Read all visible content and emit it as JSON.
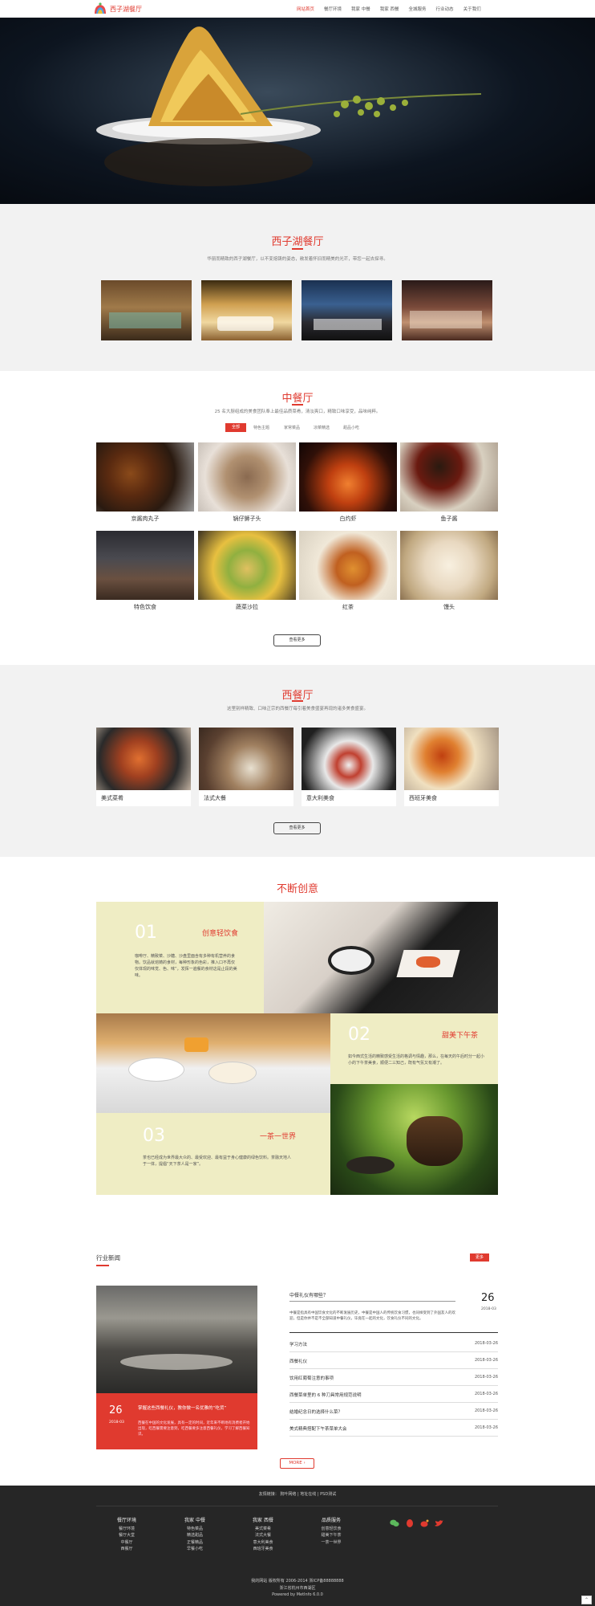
{
  "header": {
    "logo_text": "西子湖餐厅",
    "menu": [
      "网站首页",
      "餐厅环境",
      "我家 中餐",
      "我家 西餐",
      "全城服务",
      "行业动态",
      "关于我们"
    ]
  },
  "about": {
    "title": "西子湖餐厅",
    "subtitle": "华丽而精致的西子湖餐厅，以不变熔铸的姿态，敞发着怀旧而精美的光芒，带您一起去探寻。"
  },
  "chinese": {
    "title": "中餐厅",
    "subtitle": "25 名大厨组成的美食团队奉上最佳品质菜肴，清淡爽口，精致口味享受，品味纯粹。",
    "tabs": [
      "全部",
      "特色主题",
      "家常菜品",
      "凉菜精选",
      "甜品小吃"
    ],
    "dishes": [
      "京酱肉丸子",
      "锅仔狮子头",
      "白灼虾",
      "鱼子酱",
      "特色饮食",
      "蔬菜沙拉",
      "红茶",
      "馒头"
    ],
    "more": "查看更多"
  },
  "western": {
    "title": "西餐厅",
    "subtitle": "这里别样精致、口味正宗的西餐厅每引着美食盛宴再现的诸多美食盛宴。",
    "dishes": [
      "美式菜肴",
      "法式大餐",
      "意大利美食",
      "西班牙美食"
    ],
    "more": "查看更多"
  },
  "creative": {
    "title": "不断创意",
    "items": [
      {
        "num": "01",
        "title": "创意轻饮食",
        "text": "咖啡厅、精致菜、沙糖、沙盘里面含有多种有机营养的食物。饮品就熔铸的食材，每种形象的色彩，推入口不再仅仅体现的味觉、色、味”，发挥一遍餐的食材这是止段的美味。"
      },
      {
        "num": "02",
        "title": "甜美下午茶",
        "text": "如今西式生活的精致感受生活的格调与情趣，那么，在每天的午后时分一起小小的下午茶美食，顺便二三知己，既有气氛又有潮了。"
      },
      {
        "num": "03",
        "title": "一茶一世界",
        "text": "茶也已经成为世界最大众的、最受欢迎、最有益于身心健康的绿色饮料。茶融天地人于一体，提倡“天下茶人是一家”。"
      }
    ]
  },
  "news": {
    "title": "行业新闻",
    "more_btn": "更多",
    "feature": {
      "day": "26",
      "ym": "2018-03",
      "title": "掌握这些西餐礼仪，教你做一名优雅的“吃货”",
      "text": "西餐在中国的文化发展，具有一定的时间，近年来不断地有消费者开始出现，吃西餐需要注意到，吃西餐要多注意西餐礼仪，学习了解西餐知识。"
    },
    "top": {
      "title": "中餐礼仪有哪些？",
      "day": "26",
      "ym": "2018-03",
      "text": "中餐是指具有中国饮食文化的不断发展历史，中餐是中国人的传统饮食习惯，也同样受到了外国友人的欢迎，但是你并不是不全部知道中餐礼仪，毕竟在一起的文化，饮食礼仪不同的文化。"
    },
    "rows": [
      {
        "title": "学习方法",
        "date": "2018-03-26"
      },
      {
        "title": "西餐礼仪",
        "date": "2018-03-26"
      },
      {
        "title": "饮用红葡萄注意的事项",
        "date": "2018-03-26"
      },
      {
        "title": "西餐菜单里的 6 种刀具常用规范说明",
        "date": "2018-03-26"
      },
      {
        "title": "结婚纪念日的选择什么菜？",
        "date": "2018-03-26"
      },
      {
        "title": "美式精典搭配下午茶菜单大会",
        "date": "2018-03-26"
      }
    ],
    "more": "MORE"
  },
  "footer": {
    "links_label": "友情链接：",
    "links": [
      "狗叶网络",
      "地址在线",
      "PSD测试"
    ],
    "cols": [
      {
        "h": "餐厅环境",
        "items": [
          "餐厅环境",
          "餐厅大堂",
          "中餐厅",
          "西餐厅"
        ]
      },
      {
        "h": "我家 中餐",
        "items": [
          "特色菜品",
          "精选甜品",
          "正餐精品",
          "早餐小吃"
        ]
      },
      {
        "h": "我家 西餐",
        "items": [
          "美式菜肴",
          "法式大餐",
          "意大利美食",
          "西班牙美食"
        ]
      },
      {
        "h": "品质服务",
        "items": [
          "创意轻饮食",
          "甜美下午茶",
          "一茶一世界"
        ]
      }
    ],
    "copyright": "我的网站 版权所有 2006-2014 浙ICP备88888888",
    "addr": "浙江省杭州市西湖区",
    "powered": "Powered by  MetInfo  6.0.0"
  },
  "colors": {
    "accent": "#e03a2f",
    "footer_bg": "#262626",
    "cream": "#efedc4"
  }
}
